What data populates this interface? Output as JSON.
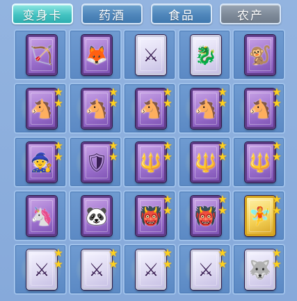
{
  "tabs": [
    {
      "label": "变身卡",
      "state": "active"
    },
    {
      "label": "药酒",
      "state": "normal"
    },
    {
      "label": "食品",
      "state": "normal"
    },
    {
      "label": "农产",
      "state": "disabled"
    }
  ],
  "colors": {
    "active_tab": "#43c3c2",
    "normal_tab": "#4f86bb",
    "disabled_tab": "#7e8a99",
    "panel_bg": "#86a9da",
    "star": "#ffd21c"
  },
  "inventory": {
    "rows": [
      [
        {
          "icon": "fairy-archer-card-icon",
          "glyph": "🏹",
          "frame": "purple",
          "stars": 0
        },
        {
          "icon": "fox-warrior-card-icon",
          "glyph": "🦊",
          "frame": "purple",
          "stars": 0
        },
        {
          "icon": "dark-knight-card-icon",
          "glyph": "⚔",
          "frame": "white",
          "stars": 0
        },
        {
          "icon": "dragon-beast-card-icon",
          "glyph": "🐉",
          "frame": "white",
          "stars": 0
        },
        {
          "icon": "monkey-king-card-icon",
          "glyph": "🐒",
          "frame": "purple",
          "stars": 0
        }
      ],
      [
        {
          "icon": "horse-warrior-card-icon",
          "glyph": "🐴",
          "frame": "purple",
          "stars": 2
        },
        {
          "icon": "horse-warrior-card-icon",
          "glyph": "🐴",
          "frame": "purple",
          "stars": 2
        },
        {
          "icon": "horse-warrior-card-icon",
          "glyph": "🐴",
          "frame": "purple",
          "stars": 2
        },
        {
          "icon": "horse-warrior-card-icon",
          "glyph": "🐴",
          "frame": "purple",
          "stars": 2
        },
        {
          "icon": "horse-warrior-card-icon",
          "glyph": "🐴",
          "frame": "purple",
          "stars": 2
        }
      ],
      [
        {
          "icon": "white-haired-sage-card-icon",
          "glyph": "🧙",
          "frame": "purple",
          "stars": 2
        },
        {
          "icon": "golden-general-card-icon",
          "glyph": "🛡",
          "frame": "purple",
          "stars": 2
        },
        {
          "icon": "red-spearman-card-icon",
          "glyph": "🔱",
          "frame": "purple",
          "stars": 2
        },
        {
          "icon": "red-spearman-card-icon",
          "glyph": "🔱",
          "frame": "purple",
          "stars": 2
        },
        {
          "icon": "red-spearman-card-icon",
          "glyph": "🔱",
          "frame": "purple",
          "stars": 2
        }
      ],
      [
        {
          "icon": "pink-fairy-beast-card-icon",
          "glyph": "🦄",
          "frame": "purple",
          "stars": 0
        },
        {
          "icon": "panda-card-icon",
          "glyph": "🐼",
          "frame": "purple",
          "stars": 0
        },
        {
          "icon": "demon-brute-card-icon",
          "glyph": "👹",
          "frame": "purple",
          "stars": 2
        },
        {
          "icon": "demon-brute-card-icon",
          "glyph": "👹",
          "frame": "purple",
          "stars": 2
        },
        {
          "icon": "red-haired-fairy-card-icon",
          "glyph": "🧚",
          "frame": "gold",
          "stars": 2
        }
      ],
      [
        {
          "icon": "dark-knight-card-icon",
          "glyph": "⚔",
          "frame": "white",
          "stars": 2
        },
        {
          "icon": "dark-knight-card-icon",
          "glyph": "⚔",
          "frame": "white",
          "stars": 2
        },
        {
          "icon": "dark-knight-card-icon",
          "glyph": "⚔",
          "frame": "white",
          "stars": 2
        },
        {
          "icon": "dark-knight-card-icon",
          "glyph": "⚔",
          "frame": "white",
          "stars": 2
        },
        {
          "icon": "spirit-beast-card-icon",
          "glyph": "🐺",
          "frame": "white",
          "stars": 2
        }
      ]
    ]
  }
}
